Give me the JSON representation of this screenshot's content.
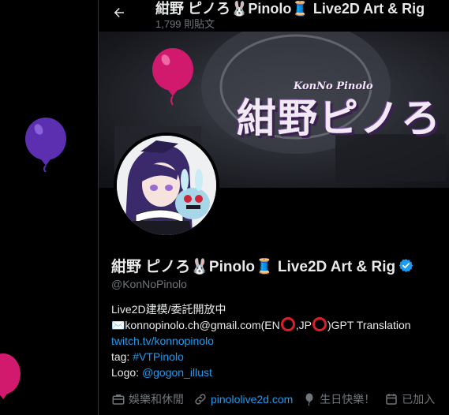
{
  "header": {
    "title": "紺野 ピノろ🐰Pinolo🧵 Live2D Art & Rig",
    "post_count": "1,799 則貼文"
  },
  "banner": {
    "logo_text": "紺野ピノろ",
    "logo_subtext": "KonNo Pinolo"
  },
  "profile": {
    "display_name": "紺野 ピノろ🐰Pinolo🧵 Live2D Art & Rig",
    "handle": "@KonNoPinolo",
    "bio": {
      "line1": "Live2D建模/委託開放中",
      "email_prefix": "✉️konnopinolo.ch@gmail.com(EN",
      "email_mid": ",JP",
      "email_suffix": ")GPT Translation",
      "link_twitch": "twitch.tv/konnopinolo",
      "tag_label": "tag: ",
      "tag_value": "#VTPinolo",
      "logo_label": "Logo: ",
      "logo_value": "@gogon_illust"
    },
    "meta": {
      "category": "娛樂和休閒",
      "website": "pinololive2d.com",
      "birthday": "生日快樂！",
      "joined": "已加入"
    }
  },
  "colors": {
    "accent": "#1d9bf0",
    "muted": "#71767b",
    "text": "#e7e9ea",
    "balloon_pink": "#d11a6d",
    "balloon_purple": "#5b2fb0",
    "verified": "#1d9bf0"
  },
  "icons": {
    "back": "arrow-left-icon",
    "verified": "verified-badge-icon",
    "category": "briefcase-icon",
    "website": "link-icon",
    "birthday": "balloon-icon",
    "joined": "calendar-icon"
  }
}
